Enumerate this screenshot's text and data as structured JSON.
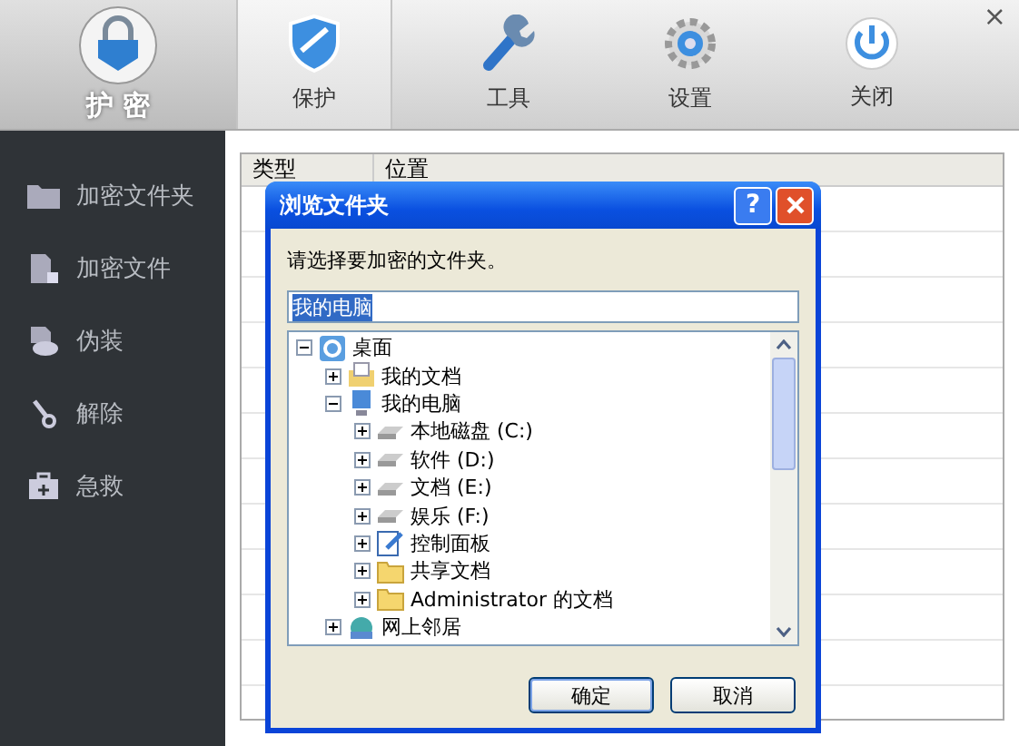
{
  "app": {
    "logo_text": "护 密",
    "close_symbol": "×"
  },
  "tabs": [
    {
      "label": "保护",
      "kind": "shield",
      "selected": true
    },
    {
      "label": "工具",
      "kind": "wrench",
      "selected": false
    },
    {
      "label": "设置",
      "kind": "gear",
      "selected": false
    },
    {
      "label": "关闭",
      "kind": "power",
      "selected": false
    }
  ],
  "sidebar": {
    "items": [
      {
        "label": "加密文件夹",
        "kind": "folder"
      },
      {
        "label": "加密文件",
        "kind": "file"
      },
      {
        "label": "伪装",
        "kind": "disguise"
      },
      {
        "label": "解除",
        "kind": "key"
      },
      {
        "label": "急救",
        "kind": "kit"
      }
    ]
  },
  "table": {
    "columns": [
      "类型",
      "位置"
    ]
  },
  "dialog": {
    "title": "浏览文件夹",
    "help_button": "?",
    "prompt": "请选择要加密的文件夹。",
    "field_value": "我的电脑",
    "tree": [
      {
        "label": "桌面",
        "kind": "desktop",
        "expanded": true,
        "children": [
          {
            "label": "我的文档",
            "kind": "documents",
            "expanded": false
          },
          {
            "label": "我的电脑",
            "kind": "computer",
            "expanded": true,
            "children": [
              {
                "label": "本地磁盘 (C:)",
                "kind": "drive",
                "expanded": false
              },
              {
                "label": "软件 (D:)",
                "kind": "drive",
                "expanded": false
              },
              {
                "label": "文档 (E:)",
                "kind": "drive",
                "expanded": false
              },
              {
                "label": "娱乐 (F:)",
                "kind": "drive",
                "expanded": false
              },
              {
                "label": "控制面板",
                "kind": "control-panel",
                "expanded": false
              },
              {
                "label": "共享文档",
                "kind": "folder",
                "expanded": false
              },
              {
                "label": "Administrator 的文档",
                "kind": "folder",
                "expanded": false
              }
            ]
          },
          {
            "label": "网上邻居",
            "kind": "network",
            "expanded": false
          }
        ]
      }
    ],
    "buttons": [
      "确定",
      "取消"
    ]
  }
}
